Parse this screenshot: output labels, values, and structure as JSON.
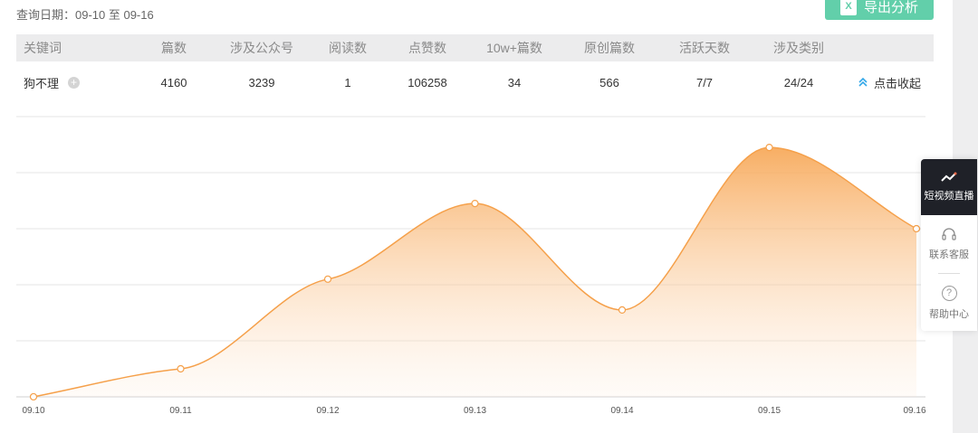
{
  "date_range": "查询日期：09-10 至 09-16",
  "export_label": "导出分析",
  "export_icon": "excel-icon",
  "table": {
    "headers": [
      "关键词",
      "篇数",
      "涉及公众号",
      "阅读数",
      "点赞数",
      "10w+篇数",
      "原创篇数",
      "活跃天数",
      "涉及类别"
    ],
    "row": [
      "狗不理",
      "4160",
      "3239",
      "1",
      "106258",
      "34",
      "566",
      "7/7",
      "24/24"
    ],
    "collapse_label": "点击收起"
  },
  "side_panel": {
    "live_label": "短视频直播",
    "service_label": "联系客服",
    "help_label": "帮助中心"
  },
  "colors": {
    "accent": "#f5a04a",
    "export": "#62cfaa",
    "link": "#34a8e8"
  },
  "chart_data": {
    "type": "area",
    "categories": [
      "09.10",
      "09.11",
      "09.12",
      "09.13",
      "09.14",
      "09.15",
      "09.16"
    ],
    "series": [
      {
        "values": [
          1,
          500,
          2100,
          3450,
          1550,
          4450,
          3000
        ]
      }
    ],
    "ylim": [
      0,
      5000
    ],
    "y_grid": [
      0,
      1000,
      2000,
      3000,
      4000,
      5000
    ],
    "grid": true,
    "ytick_labels_visible": false,
    "title": "",
    "xlabel": "",
    "ylabel": ""
  }
}
